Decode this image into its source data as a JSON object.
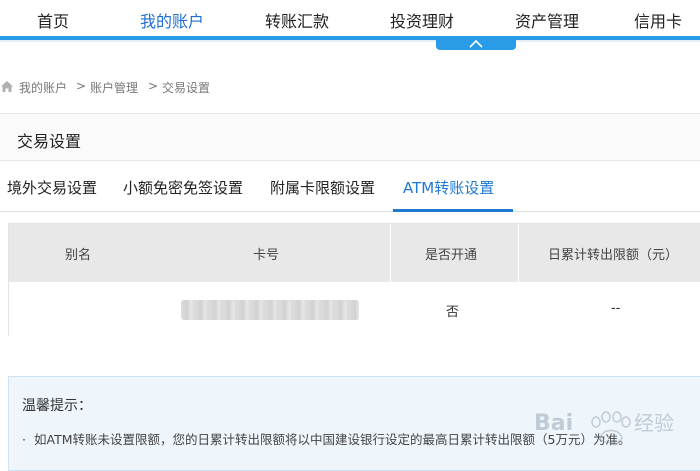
{
  "nav": {
    "items": [
      "首页",
      "我的账户",
      "转账汇款",
      "投资理财",
      "资产管理",
      "信用卡"
    ],
    "active_index": 1,
    "accent": "#2a9be6"
  },
  "breadcrumb": {
    "items": [
      "我的账户",
      "账户管理",
      "交易设置"
    ],
    "separator": ">"
  },
  "page": {
    "title": "交易设置"
  },
  "tabs": {
    "items": [
      "境外交易设置",
      "小额免密免签设置",
      "附属卡限额设置",
      "ATM转账设置"
    ],
    "active_index": 3,
    "active_color": "#1f78d1"
  },
  "table": {
    "headers": [
      "别名",
      "卡号",
      "是否开通",
      "日累计转出限额（元）"
    ],
    "rows": [
      {
        "alias": "",
        "card": "",
        "enabled": "否",
        "limit": "--"
      }
    ]
  },
  "tip": {
    "title": "温馨提示：",
    "text": "如ATM转账未设置限额，您的日累计转出限额将以中国建设银行设定的最高日累计转出限额（5万元）为准。"
  },
  "watermark": {
    "text": "Bai 经验"
  }
}
